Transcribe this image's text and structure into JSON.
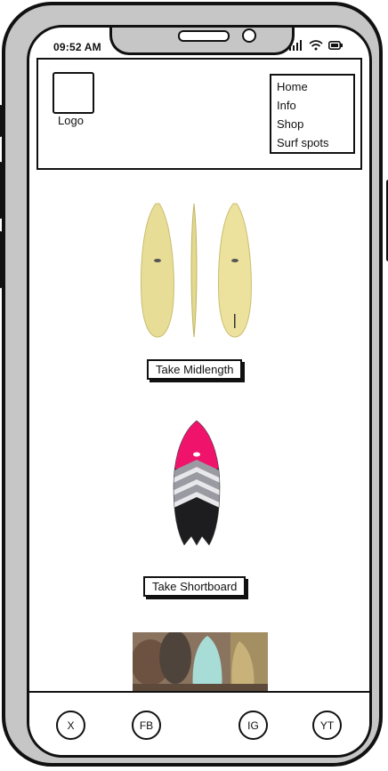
{
  "status_bar": {
    "time": "09:52 AM"
  },
  "header": {
    "logo_label": "Logo",
    "nav": [
      "Home",
      "Info",
      "Shop",
      "Surf spots"
    ]
  },
  "products": [
    {
      "cta": "Take Midlength"
    },
    {
      "cta": "Take Shortboard"
    }
  ],
  "footer": {
    "social": [
      "X",
      "FB",
      "IG",
      "YT"
    ]
  },
  "colors": {
    "midlength_board": "#e8dd96",
    "shortboard_nose": "#f0136b",
    "shortboard_tail": "#1d1d1f"
  }
}
